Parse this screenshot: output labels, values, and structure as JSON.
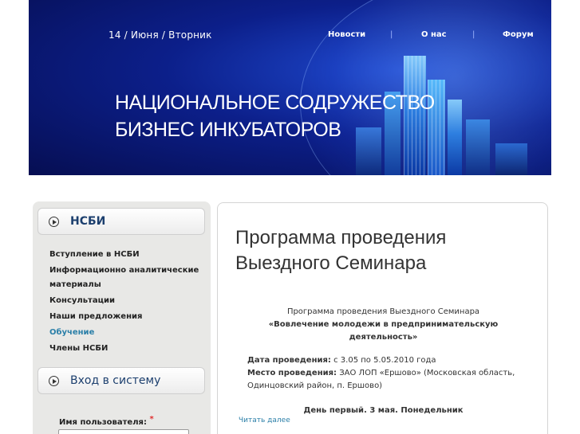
{
  "header": {
    "date": "14 / Июня / Вторник",
    "nav": [
      "Новости",
      "О нас",
      "Форум"
    ],
    "title_line1": "НАЦИОНАЛЬНОЕ СОДРУЖЕСТВО",
    "title_line2": "БИЗНЕС ИНКУБАТОРОВ"
  },
  "sidebar": {
    "section1_title": "НСБИ",
    "items": [
      "Вступление в НСБИ",
      "Информационно аналитические",
      "материалы",
      "Консультации",
      "Наши предложения",
      "Обучение",
      "Члены НСБИ"
    ],
    "active_item": "Обучение",
    "section2_title": "Вход в систему",
    "username_label": "Имя пользователя:",
    "required_mark": "*"
  },
  "article": {
    "title_line1": "Программа  проведения",
    "title_line2": "Выездного Семинара",
    "subtitle": "Программа  проведения Выездного Семинара",
    "topic_line1": "«Вовлечение молодежи в предпринимательскую",
    "topic_line2": "деятельность»",
    "date_label": "Дата проведения:",
    "date_value": "с 3.05 по 5.05.2010 года",
    "place_label": "Место проведения:",
    "place_value": "ЗАО ЛОП «Ершово» (Московская область,",
    "place_value2": "Одинцовский район, п. Ершово)",
    "day_heading": "День первый. 3 мая. Понедельник",
    "read_more": "Читать далее"
  },
  "colors": {
    "header_bg": "#0c1f8a",
    "link": "#2b7fa8",
    "sidebar_bg": "#e8e8e6"
  }
}
